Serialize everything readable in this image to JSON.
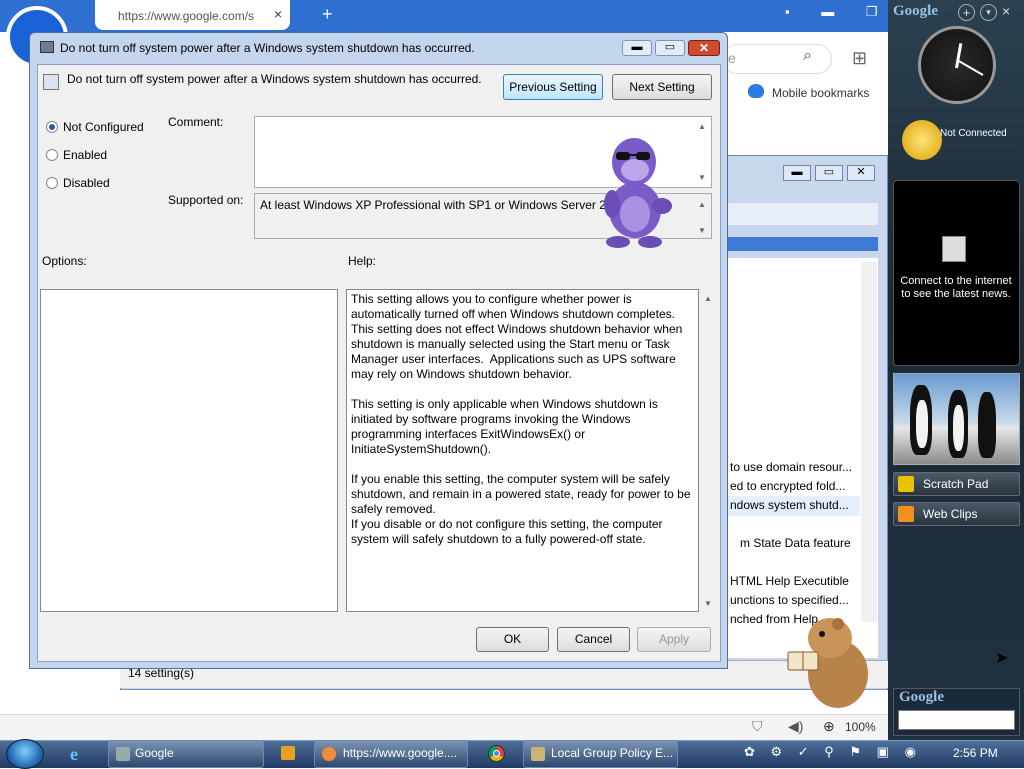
{
  "browser": {
    "tab_url": "https://www.google.com/s",
    "tab_close": "×",
    "new_tab": "+",
    "window_controls": "▪ ▬ ❐ ✕",
    "search_partial": "e",
    "mobile_bookmarks": "Mobile bookmarks",
    "zoom": "100%"
  },
  "gp_window": {
    "rows": [
      "to use domain resour...",
      "ed to encrypted fold...",
      "ndows system shutd...",
      "m State Data feature",
      "HTML Help Executible",
      "unctions to specified...",
      "nched from Help..."
    ],
    "status": "14 setting(s)",
    "controls": {
      "min": "▬",
      "max": "▭",
      "close": "✕"
    }
  },
  "dialog": {
    "title": "Do not turn off system power after a Windows system shutdown has occurred.",
    "setting_name": "Do not turn off system power after a Windows system shutdown has occurred.",
    "controls": {
      "min": "▬",
      "max": "▭",
      "close": "✕"
    },
    "prev_label": "Previous Setting",
    "next_label": "Next Setting",
    "radios": [
      {
        "label": "Not Configured",
        "checked": true
      },
      {
        "label": "Enabled",
        "checked": false
      },
      {
        "label": "Disabled",
        "checked": false
      }
    ],
    "comment_label": "Comment:",
    "supported_label": "Supported on:",
    "supported_text": "At least Windows XP Professional with SP1 or Windows Server 2003",
    "options_label": "Options:",
    "help_label": "Help:",
    "help_text": "This setting allows you to configure whether power is automatically turned off when Windows shutdown completes. This setting does not effect Windows shutdown behavior when shutdown is manually selected using the Start menu or Task Manager user interfaces.  Applications such as UPS software may rely on Windows shutdown behavior.\n\nThis setting is only applicable when Windows shutdown is initiated by software programs invoking the Windows programming interfaces ExitWindowsEx() or InitiateSystemShutdown().\n\nIf you enable this setting, the computer system will be safely shutdown, and remain in a powered state, ready for power to be safely removed.\nIf you disable or do not configure this setting, the computer system will safely shutdown to a fully powered-off state.",
    "ok_label": "OK",
    "cancel_label": "Cancel",
    "apply_label": "Apply"
  },
  "sidebar": {
    "logo": "Google",
    "plus": "+",
    "menu": "▾",
    "close": "×",
    "weather_status": "Not Connected",
    "news_text": "Connect to the internet to see the latest news.",
    "items": [
      {
        "label": "Scratch Pad",
        "icon": "notepad-icon",
        "color": "#e8c400"
      },
      {
        "label": "Web Clips",
        "icon": "rss-icon",
        "color": "#f0901e"
      }
    ],
    "search_logo": "Google"
  },
  "taskbar": {
    "items": [
      {
        "label": "Google",
        "icon": "google-desktop-icon"
      },
      {
        "label": "https://www.google....",
        "icon": "browser-icon"
      },
      {
        "label": "Local Group Policy E...",
        "icon": "policy-editor-icon"
      }
    ],
    "tray_icons": "✿ ⚙ ✓ ⚲ ⚑ ▣ ◉",
    "time": "2:56 PM"
  },
  "colors": {
    "accent": "#2e6fd1",
    "taskbar": "#1f3a63",
    "close_button": "#d24a30"
  }
}
